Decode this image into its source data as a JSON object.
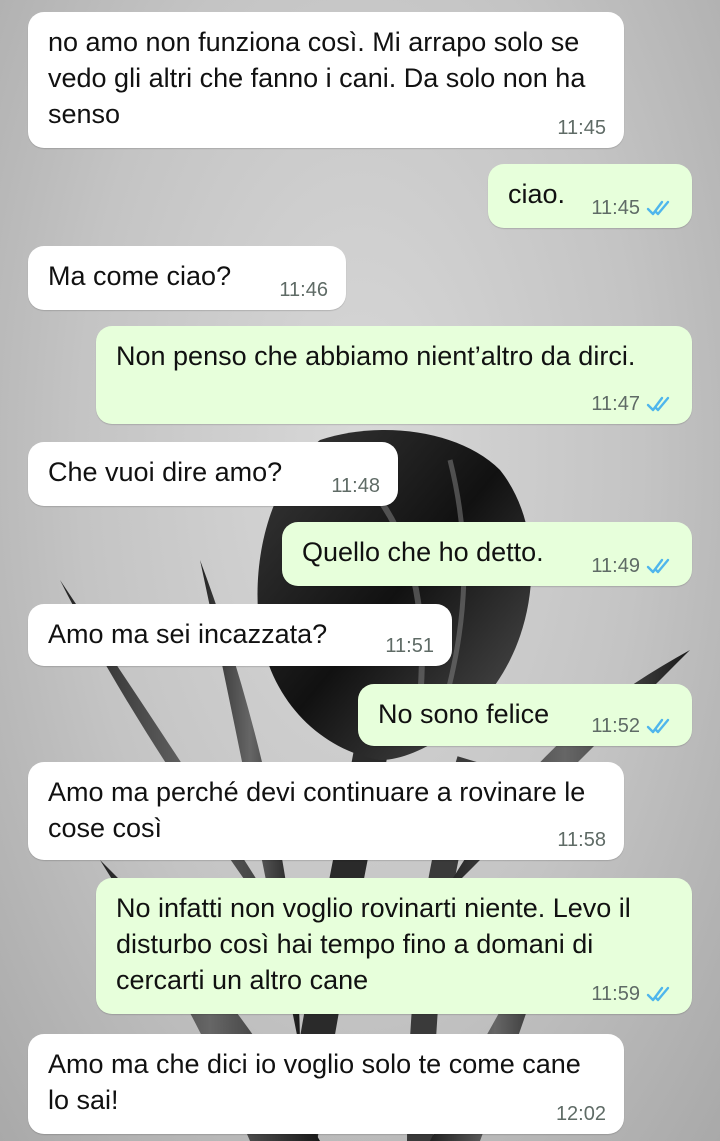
{
  "colors": {
    "incoming_bubble": "#ffffff",
    "outgoing_bubble": "#e7ffdb",
    "read_ticks": "#4fb6ec",
    "timestamp": "#5f6b66"
  },
  "wallpaper": {
    "subject": "black-and-white tulip"
  },
  "messages": [
    {
      "dir": "in",
      "text": "no amo non funziona così. Mi arrapo solo se vedo gli altri che fanno i cani. Da solo non ha senso",
      "time": "11:45"
    },
    {
      "dir": "out",
      "text": "ciao.",
      "time": "11:45",
      "status": "read"
    },
    {
      "dir": "in",
      "text": "Ma come ciao?",
      "time": "11:46"
    },
    {
      "dir": "out",
      "text": "Non penso che abbiamo nient’altro da dirci.",
      "time": "11:47",
      "status": "read"
    },
    {
      "dir": "in",
      "text": "Che vuoi dire amo?",
      "time": "11:48"
    },
    {
      "dir": "out",
      "text": "Quello che ho detto.",
      "time": "11:49",
      "status": "read"
    },
    {
      "dir": "in",
      "text": "Amo ma sei incazzata?",
      "time": "11:51"
    },
    {
      "dir": "out",
      "text": "No sono felice",
      "time": "11:52",
      "status": "read"
    },
    {
      "dir": "in",
      "text": "Amo ma perché devi continuare a rovinare le cose così",
      "time": "11:58"
    },
    {
      "dir": "out",
      "text": "No infatti non voglio rovinarti niente. Levo il disturbo così hai tempo fino a domani di cercarti un altro cane",
      "time": "11:59",
      "status": "read"
    },
    {
      "dir": "in",
      "text": "Amo ma che dici io voglio solo te come cane lo sai!",
      "time": "12:02"
    }
  ]
}
